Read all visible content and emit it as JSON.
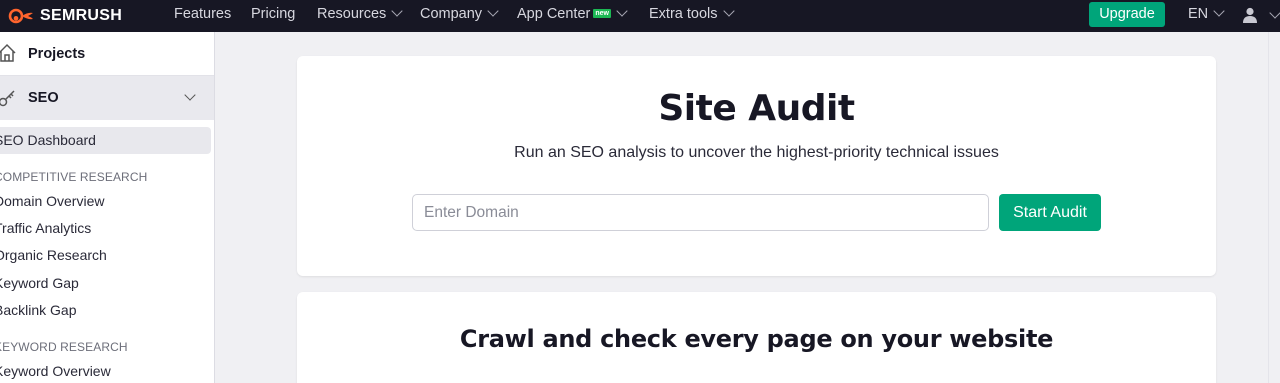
{
  "brand": {
    "name": "SEMRUSH",
    "accent_color": "#00a57a",
    "logo_color": "#ff642d",
    "nav_bg": "#171724"
  },
  "nav": {
    "items": [
      {
        "label": "Features",
        "dropdown": false
      },
      {
        "label": "Pricing",
        "dropdown": false
      },
      {
        "label": "Resources",
        "dropdown": true
      },
      {
        "label": "Company",
        "dropdown": true
      },
      {
        "label": "App Center",
        "dropdown": true,
        "badge": "new"
      },
      {
        "label": "Extra tools",
        "dropdown": true
      }
    ],
    "upgrade_label": "Upgrade",
    "language": "EN",
    "user_icon": "user-icon"
  },
  "sidebar": {
    "projects_label": "Projects",
    "seo_label": "SEO",
    "active_item": "SEO Dashboard",
    "sections": [
      {
        "heading": "COMPETITIVE RESEARCH",
        "items": [
          "Domain Overview",
          "Traffic Analytics",
          "Organic Research",
          "Keyword Gap",
          "Backlink Gap"
        ]
      },
      {
        "heading": "KEYWORD RESEARCH",
        "items": [
          "Keyword Overview"
        ]
      }
    ]
  },
  "main": {
    "title": "Site Audit",
    "subtitle": "Run an SEO analysis to uncover the highest-priority technical issues",
    "domain_input": {
      "placeholder": "Enter Domain",
      "value": ""
    },
    "start_button": "Start Audit",
    "section2_title": "Crawl and check every page on your website"
  }
}
